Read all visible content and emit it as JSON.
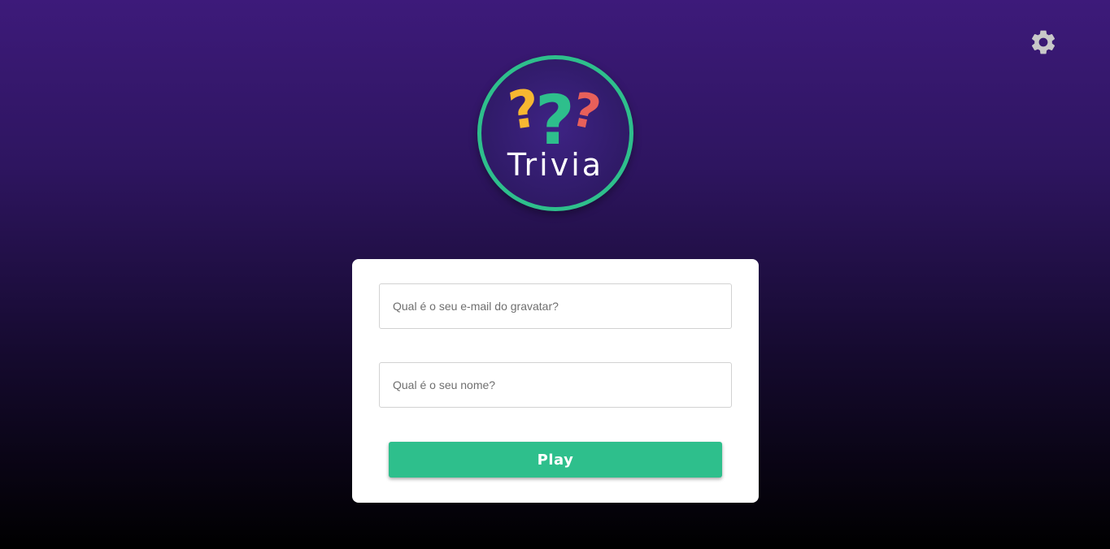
{
  "header": {
    "settings_icon": "gear-icon"
  },
  "logo": {
    "title": "Trivia",
    "question_mark": "?",
    "colors": {
      "ring": "#2ebf8c",
      "mark_yellow": "#f7b731",
      "mark_green": "#2ebf8c",
      "mark_red": "#e8605a"
    }
  },
  "form": {
    "email_placeholder": "Qual é o seu e-mail do gravatar?",
    "name_placeholder": "Qual é o seu nome?",
    "play_label": "Play"
  },
  "colors": {
    "accent": "#2ebf8c",
    "background_top": "#3d1a7a",
    "background_bottom": "#000000",
    "settings_icon": "#c8c8c8"
  }
}
